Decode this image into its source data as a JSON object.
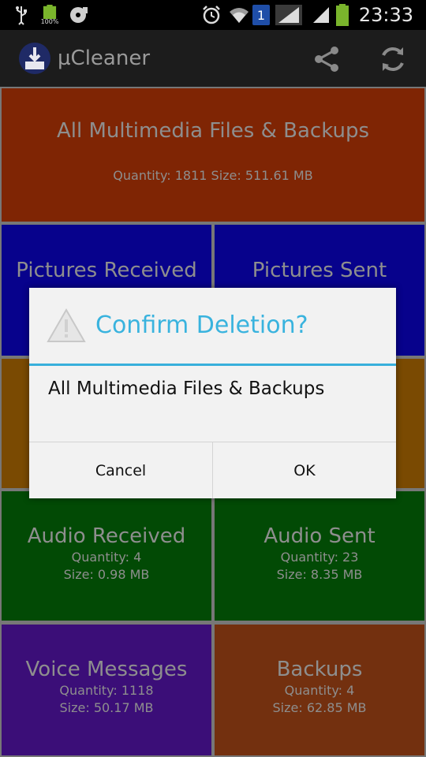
{
  "status_bar": {
    "time": "23:33",
    "battery_small_label": "100%",
    "notification_badge": "1",
    "icons": [
      "usb-icon",
      "battery-full-icon",
      "sd-card-icon",
      "alarm-icon",
      "wifi-icon",
      "notification-badge-icon",
      "signal-icon",
      "signal-icon",
      "battery-icon"
    ]
  },
  "action_bar": {
    "title": "µCleaner",
    "icons": [
      "app-logo-icon",
      "share-icon",
      "refresh-icon"
    ]
  },
  "tiles": {
    "all": {
      "title": "All Multimedia Files & Backups",
      "line1": "Quantity: 1811 Size: 511.61 MB",
      "color": "#7f2504"
    },
    "pictures_received": {
      "title": "Pictures Received",
      "color": "#07028c"
    },
    "pictures_sent": {
      "title": "Pictures Sent",
      "color": "#07028c"
    },
    "videos_received": {
      "color": "#7a4a02"
    },
    "videos_sent": {
      "color": "#7a4a02"
    },
    "audio_received": {
      "title": "Audio Received",
      "line1": "Quantity: 4",
      "line2": "Size: 0.98 MB",
      "color": "#024a05"
    },
    "audio_sent": {
      "title": "Audio Sent",
      "line1": "Quantity: 23",
      "line2": "Size: 8.35 MB",
      "color": "#024a05"
    },
    "voice_messages": {
      "title": "Voice Messages",
      "line1": "Quantity: 1118",
      "line2": "Size: 50.17 MB",
      "color": "#3b0e78"
    },
    "backups": {
      "title": "Backups",
      "line1": "Quantity: 4",
      "line2": "Size: 62.85 MB",
      "color": "#73300f"
    }
  },
  "dialog": {
    "title": "Confirm Deletion?",
    "message": "All Multimedia Files & Backups",
    "cancel_label": "Cancel",
    "ok_label": "OK",
    "accent_color": "#39b3de",
    "icon": "warning-icon"
  }
}
